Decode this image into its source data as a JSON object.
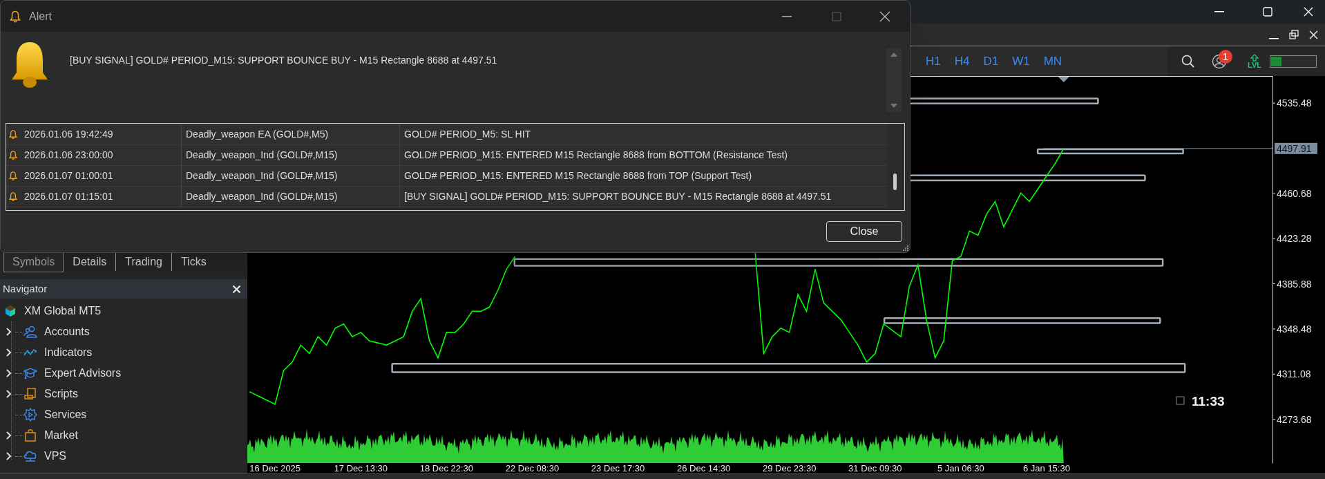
{
  "alert_dialog": {
    "title": "Alert",
    "message": "[BUY SIGNAL] GOLD# PERIOD_M15: SUPPORT BOUNCE BUY - M15 Rectangle 8688 at 4497.51",
    "alerts": [
      {
        "time": "2026.01.06 19:42:49",
        "source": "Deadly_weapon EA (GOLD#,M5)",
        "message": "GOLD# PERIOD_M5: SL HIT"
      },
      {
        "time": "2026.01.06 23:00:00",
        "source": "Deadly_weapon_Ind (GOLD#,M15)",
        "message": "GOLD# PERIOD_M15: ENTERED M15 Rectangle 8688 from BOTTOM (Resistance Test)"
      },
      {
        "time": "2026.01.07 01:00:01",
        "source": "Deadly_weapon_Ind (GOLD#,M15)",
        "message": "GOLD# PERIOD_M15: ENTERED M15 Rectangle 8688 from TOP (Support Test)"
      },
      {
        "time": "2026.01.07 01:15:01",
        "source": "Deadly_weapon_Ind (GOLD#,M15)",
        "message": "[BUY SIGNAL] GOLD# PERIOD_M15: SUPPORT BOUNCE BUY - M15 Rectangle 8688 at 4497.51"
      }
    ],
    "close_button": "Close"
  },
  "toolbar": {
    "timeframes": [
      {
        "label": "H1"
      },
      {
        "label": "H4"
      },
      {
        "label": "D1"
      },
      {
        "label": "W1"
      },
      {
        "label": "MN"
      }
    ],
    "notification_count": "1",
    "level_indicator": {
      "label": "LVL",
      "level": 0.23
    }
  },
  "sidebar": {
    "tabs": [
      {
        "label": "Symbols",
        "selected": true
      },
      {
        "label": "Details",
        "selected": false
      },
      {
        "label": "Trading",
        "selected": false
      },
      {
        "label": "Ticks",
        "selected": false
      }
    ],
    "navigator": {
      "title": "Navigator",
      "items": [
        {
          "label": "XM Global MT5",
          "kind": "broker",
          "children": [
            {
              "label": "Accounts",
              "kind": "accounts",
              "expandable": true
            },
            {
              "label": "Indicators",
              "kind": "indicators",
              "expandable": true
            },
            {
              "label": "Expert Advisors",
              "kind": "experts",
              "expandable": true
            },
            {
              "label": "Scripts",
              "kind": "scripts",
              "expandable": true
            },
            {
              "label": "Services",
              "kind": "services",
              "expandable": false
            },
            {
              "label": "Market",
              "kind": "market",
              "expandable": true
            },
            {
              "label": "VPS",
              "kind": "vps",
              "expandable": true
            }
          ]
        }
      ]
    }
  },
  "chart": {
    "current_price": "4497.91",
    "countdown": "11:33",
    "chart_data": {
      "type": "line",
      "ylim": [
        4237.4,
        4557.9
      ],
      "categories": [
        null,
        null,
        null,
        "16 Dec 2025",
        null,
        null,
        null,
        null,
        null,
        null,
        null,
        null,
        null,
        "17 Dec 13:30",
        null,
        null,
        null,
        null,
        null,
        null,
        null,
        null,
        null,
        "18 Dec 22:30",
        null,
        null,
        null,
        null,
        null,
        null,
        null,
        null,
        null,
        "22 Dec 08:30",
        null,
        null,
        null,
        null,
        null,
        null,
        null,
        null,
        null,
        "23 Dec 17:30",
        null,
        null,
        null,
        null,
        null,
        null,
        null,
        null,
        null,
        "26 Dec 14:30",
        null,
        null,
        null,
        null,
        null,
        null,
        null,
        null,
        null,
        "29 Dec 23:30",
        null,
        null,
        null,
        null,
        null,
        null,
        null,
        null,
        null,
        "31 Dec 09:30",
        null,
        null,
        null,
        null,
        null,
        null,
        null,
        null,
        null,
        "5 Jan 06:30",
        null,
        null,
        null,
        null,
        null,
        null,
        null,
        null,
        null,
        "6 Jan 15:30",
        null,
        null,
        null,
        null,
        null,
        null,
        null,
        null,
        null,
        null,
        null,
        null,
        null,
        null,
        null,
        null,
        null,
        null,
        null,
        null,
        null,
        null,
        null,
        null,
        null,
        null
      ],
      "yticks": [
        {
          "value": 4535.48,
          "label": "4535.48"
        },
        {
          "value": 4460.68,
          "label": "4460.68"
        },
        {
          "value": 4423.28,
          "label": "4423.28"
        },
        {
          "value": 4385.88,
          "label": "4385.88"
        },
        {
          "value": 4348.48,
          "label": "4348.48"
        },
        {
          "value": 4311.08,
          "label": "4311.08"
        },
        {
          "value": 4273.68,
          "label": "4273.68"
        }
      ],
      "series": [
        {
          "color": "#00ff00",
          "values": [
            4296.6,
            4293.1,
            4289.6,
            4286.1,
            4314.1,
            4321.1,
            4335.1,
            4328.1,
            4342.1,
            4335.1,
            4349.1,
            4352.6,
            4342.1,
            4345.6,
            4338.6,
            4336.9,
            4335.1,
            4338.6,
            4342.1,
            4363.1,
            4373.6,
            4338.6,
            4324.6,
            4345.6,
            4345.6,
            4352.6,
            4363.1,
            4363.1,
            4366.6,
            4380.5,
            4398.0,
            4408.5,
            null,
            null,
            null,
            null,
            null,
            null,
            null,
            null,
            null,
            null,
            null,
            null,
            null,
            null,
            null,
            null,
            null,
            null,
            null,
            null,
            null,
            null,
            null,
            null,
            null,
            null,
            null,
            4412.0,
            4328.1,
            4342.1,
            4349.1,
            4345.6,
            4377.0,
            4363.1,
            4398.0,
            4370.0,
            4363.1,
            4356.1,
            4345.6,
            4335.1,
            4321.1,
            4328.1,
            4352.6,
            4347.4,
            4342.1,
            4384.0,
            4401.5,
            4356.1,
            4324.6,
            4338.6,
            4405.0,
            4408.5,
            4429.5,
            4426.0,
            4443.5,
            4454.0,
            4433.0,
            4447.0,
            4461.0,
            4454.0,
            4464.5,
            4475.0,
            4485.5,
            4497.9,
            null,
            null,
            null,
            null,
            null,
            null,
            null,
            null,
            null,
            null,
            null,
            null,
            null,
            null,
            null,
            null,
            null,
            null,
            null,
            null,
            null,
            null,
            null,
            null
          ]
        }
      ]
    }
  }
}
